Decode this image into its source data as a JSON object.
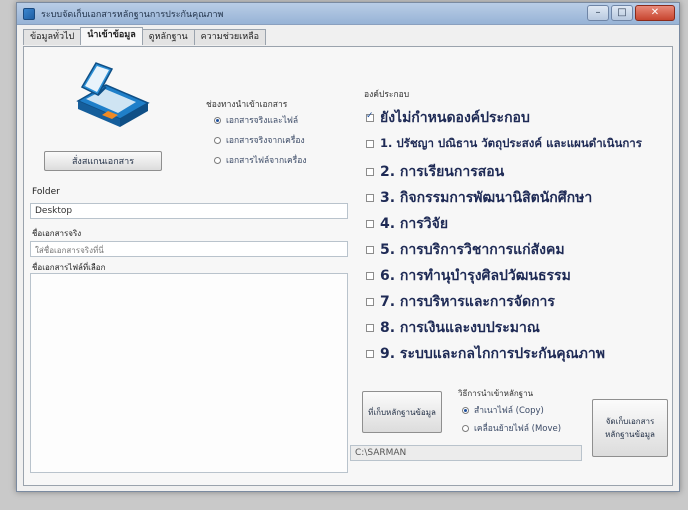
{
  "window": {
    "title": "ระบบจัดเก็บเอกสารหลักฐานการประกันคุณภาพ",
    "minimize": "–",
    "maximize": "□",
    "close": "✕"
  },
  "tabs": [
    {
      "label": "ข้อมูลทั่วไป",
      "active": false
    },
    {
      "label": "นำเข้าข้อมูล",
      "active": true
    },
    {
      "label": "ดูหลักฐาน",
      "active": false
    },
    {
      "label": "ความช่วยเหลือ",
      "active": false
    }
  ],
  "scan_button": "สั่งสแกนเอกสาร",
  "scan_source": {
    "title": "ช่องทางนำเข้าเอกสาร",
    "options": [
      {
        "label": "เอกสารจริงและไฟล์",
        "selected": true
      },
      {
        "label": "เอกสารจริงจากเครื่อง",
        "selected": false
      },
      {
        "label": "เอกสารไฟล์จากเครื่อง",
        "selected": false
      }
    ]
  },
  "folder": {
    "label": "Folder",
    "value": "Desktop"
  },
  "document_name": {
    "label": "ชื่อเอกสารจริง",
    "value": "ใส่ชื่อเอกสารจริงที่นี่"
  },
  "file_name": {
    "label": "ชื่อเอกสารไฟล์ที่เลือก",
    "value": ""
  },
  "components": {
    "title": "องค์ประกอบ",
    "items": [
      {
        "label": "ยังไม่กำหนดองค์ประกอบ",
        "checked": true
      },
      {
        "label": "1. ปรัชญา ปณิธาน วัตถุประสงค์ และแผนดำเนินการ",
        "checked": false
      },
      {
        "label": "2. การเรียนการสอน",
        "checked": false
      },
      {
        "label": "3. กิจกรรมการพัฒนานิสิตนักศึกษา",
        "checked": false
      },
      {
        "label": "4. การวิจัย",
        "checked": false
      },
      {
        "label": "5. การบริการวิชาการแก่สังคม",
        "checked": false
      },
      {
        "label": "6. การทำนุบำรุงศิลปวัฒนธรรม",
        "checked": false
      },
      {
        "label": "7. การบริหารและการจัดการ",
        "checked": false
      },
      {
        "label": "8. การเงินและงบประมาณ",
        "checked": false
      },
      {
        "label": "9. ระบบและกลไกการประกันคุณภาพ",
        "checked": false
      }
    ]
  },
  "store_path_button": "ที่เก็บหลักฐานข้อมูล",
  "store_path": "C:\\SARMAN",
  "file_method": {
    "title": "วิธีการนำเข้าหลักฐาน",
    "options": [
      {
        "label": "สำเนาไฟล์ (Copy)",
        "selected": true
      },
      {
        "label": "เคลื่อนย้ายไฟล์ (Move)",
        "selected": false
      }
    ]
  },
  "save_button": "จัดเก็บเอกสาร หลักฐานข้อมูล",
  "colors": {
    "accent": "#1d4f9c",
    "text": "#1e2a55",
    "title_bar": "#97b3d6",
    "close": "#c7452f"
  },
  "icons": {
    "scanner": "scanner-icon",
    "app": "app-icon"
  }
}
